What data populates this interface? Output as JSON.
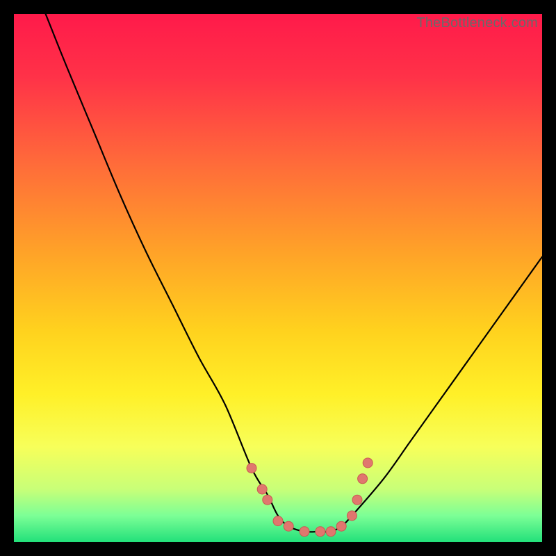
{
  "watermark": "TheBottleneck.com",
  "chart_data": {
    "type": "line",
    "title": "",
    "xlabel": "",
    "ylabel": "",
    "xlim": [
      0,
      100
    ],
    "ylim": [
      0,
      100
    ],
    "background_gradient": {
      "stops": [
        {
          "offset": 0.0,
          "color": "#ff1a4a"
        },
        {
          "offset": 0.12,
          "color": "#ff3248"
        },
        {
          "offset": 0.28,
          "color": "#ff6a3a"
        },
        {
          "offset": 0.45,
          "color": "#ffa228"
        },
        {
          "offset": 0.6,
          "color": "#ffd21e"
        },
        {
          "offset": 0.72,
          "color": "#fff028"
        },
        {
          "offset": 0.82,
          "color": "#f7ff5a"
        },
        {
          "offset": 0.9,
          "color": "#c8ff78"
        },
        {
          "offset": 0.95,
          "color": "#7cff96"
        },
        {
          "offset": 1.0,
          "color": "#22e07a"
        }
      ]
    },
    "series": [
      {
        "name": "bottleneck-curve",
        "x": [
          6,
          10,
          15,
          20,
          25,
          30,
          35,
          40,
          45,
          48,
          50,
          52,
          55,
          58,
          60,
          62,
          64,
          70,
          75,
          80,
          85,
          90,
          95,
          100
        ],
        "y": [
          100,
          90,
          78,
          66,
          55,
          45,
          35,
          26,
          14,
          9,
          5,
          3,
          2,
          2,
          2,
          3,
          5,
          12,
          19,
          26,
          33,
          40,
          47,
          54
        ]
      }
    ],
    "markers": [
      {
        "x": 45,
        "y": 14
      },
      {
        "x": 47,
        "y": 10
      },
      {
        "x": 48,
        "y": 8
      },
      {
        "x": 50,
        "y": 4
      },
      {
        "x": 52,
        "y": 3
      },
      {
        "x": 55,
        "y": 2
      },
      {
        "x": 58,
        "y": 2
      },
      {
        "x": 60,
        "y": 2
      },
      {
        "x": 62,
        "y": 3
      },
      {
        "x": 64,
        "y": 5
      },
      {
        "x": 65,
        "y": 8
      },
      {
        "x": 66,
        "y": 12
      },
      {
        "x": 67,
        "y": 15
      }
    ],
    "marker_style": {
      "fill": "#e0776e",
      "stroke": "#c95a52",
      "r": 7
    }
  }
}
